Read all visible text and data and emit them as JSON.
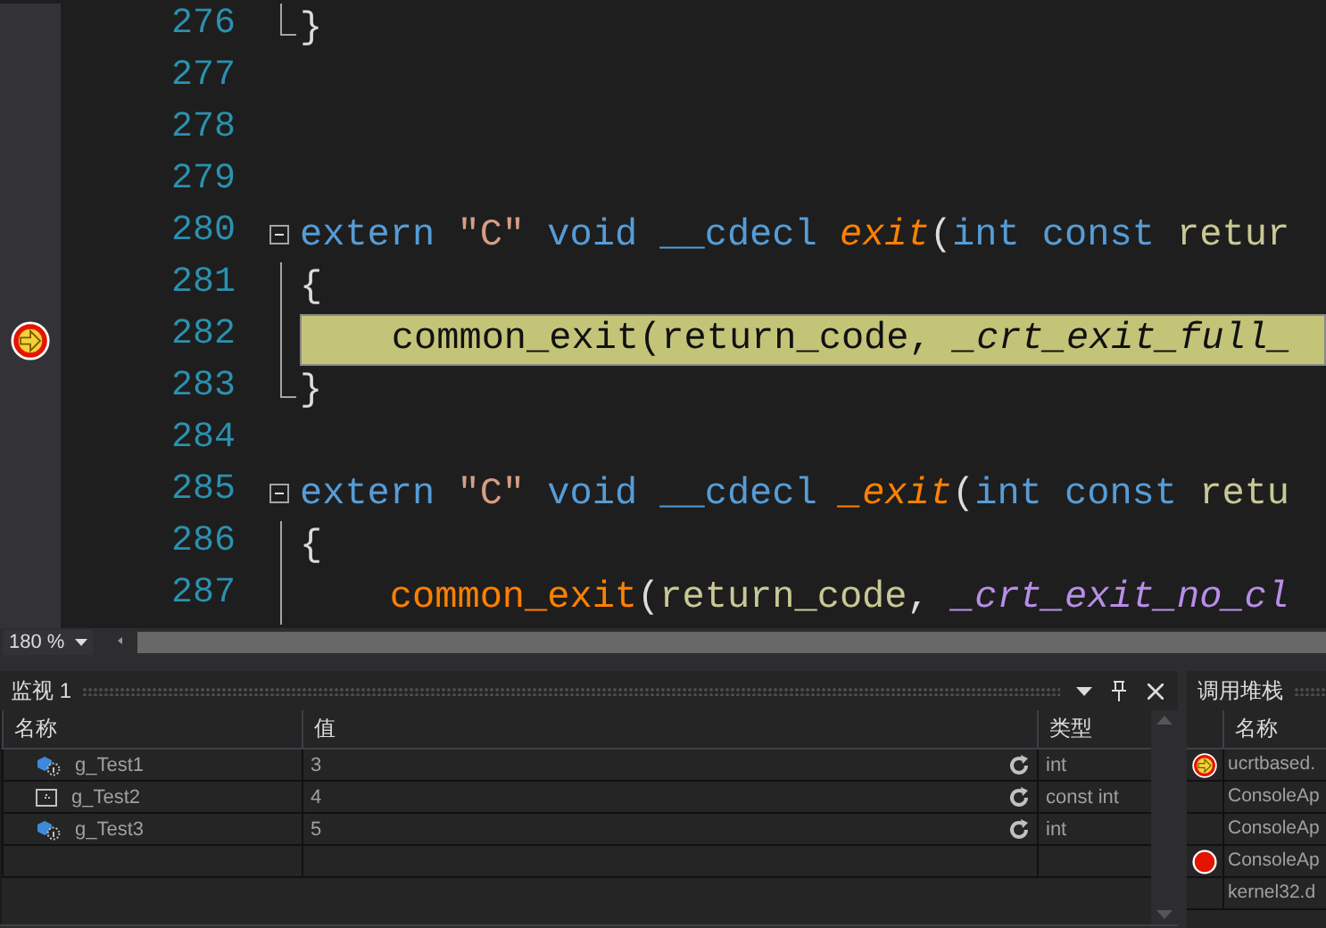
{
  "editor": {
    "zoom": "180 %",
    "lines": [
      {
        "number": "276",
        "collapsible": false,
        "in_block": true,
        "block_end": true,
        "current": false,
        "tokens": [
          {
            "kind": "plain",
            "text": "}"
          }
        ]
      },
      {
        "number": "277",
        "collapsible": false,
        "in_block": false,
        "block_end": false,
        "current": false
      },
      {
        "number": "278",
        "collapsible": false,
        "in_block": false,
        "block_end": false,
        "current": false
      },
      {
        "number": "279",
        "collapsible": false,
        "in_block": false,
        "block_end": false,
        "current": false
      },
      {
        "number": "280",
        "collapsible": true,
        "in_block": false,
        "block_end": false,
        "current": false,
        "tokens": [
          {
            "kind": "keyword",
            "text": "extern "
          },
          {
            "kind": "string",
            "text": "\"C\""
          },
          {
            "kind": "keyword",
            "text": " void __cdecl "
          },
          {
            "kind": "function_italic",
            "text": "exit"
          },
          {
            "kind": "plain",
            "text": "("
          },
          {
            "kind": "keyword",
            "text": "int const "
          },
          {
            "kind": "param",
            "text": "retur"
          }
        ]
      },
      {
        "number": "281",
        "collapsible": false,
        "in_block": true,
        "block_end": false,
        "current": false,
        "tokens": [
          {
            "kind": "plain",
            "text": "{"
          }
        ]
      },
      {
        "number": "282",
        "collapsible": false,
        "in_block": true,
        "block_end": false,
        "current": true,
        "tokens": [
          {
            "kind": "plain",
            "text": "    common_exit(return_code, "
          },
          {
            "kind": "macro",
            "text": "_crt_exit_full_"
          }
        ]
      },
      {
        "number": "283",
        "collapsible": false,
        "in_block": true,
        "block_end": true,
        "current": false,
        "tokens": [
          {
            "kind": "plain",
            "text": "}"
          }
        ]
      },
      {
        "number": "284",
        "collapsible": false,
        "in_block": false,
        "block_end": false,
        "current": false
      },
      {
        "number": "285",
        "collapsible": true,
        "in_block": false,
        "block_end": false,
        "current": false,
        "tokens": [
          {
            "kind": "keyword",
            "text": "extern "
          },
          {
            "kind": "string",
            "text": "\"C\""
          },
          {
            "kind": "keyword",
            "text": " void __cdecl "
          },
          {
            "kind": "function_italic",
            "text": "_exit"
          },
          {
            "kind": "plain",
            "text": "("
          },
          {
            "kind": "keyword",
            "text": "int const "
          },
          {
            "kind": "param",
            "text": "retu"
          }
        ]
      },
      {
        "number": "286",
        "collapsible": false,
        "in_block": true,
        "block_end": false,
        "current": false,
        "tokens": [
          {
            "kind": "plain",
            "text": "{"
          }
        ]
      },
      {
        "number": "287",
        "collapsible": false,
        "in_block": true,
        "block_end": false,
        "current": false,
        "tokens": [
          {
            "kind": "function",
            "text": "    common_exit"
          },
          {
            "kind": "plain",
            "text": "("
          },
          {
            "kind": "param",
            "text": "return_code"
          },
          {
            "kind": "plain",
            "text": ", "
          },
          {
            "kind": "macro",
            "text": "_crt_exit_no_cl"
          }
        ]
      }
    ]
  },
  "watch": {
    "title": "监视 1",
    "columns": [
      "名称",
      "值",
      "类型"
    ],
    "rows": [
      {
        "kind": "variable",
        "name": "g_Test1",
        "value": "3",
        "type": "int"
      },
      {
        "kind": "constant",
        "name": "g_Test2",
        "value": "4",
        "type": "const int"
      },
      {
        "kind": "variable",
        "name": "g_Test3",
        "value": "5",
        "type": "int"
      }
    ]
  },
  "call_stack": {
    "title": "调用堆栈",
    "columns": [
      "名称"
    ],
    "rows": [
      {
        "kind": "current",
        "name": "ucrtbased."
      },
      {
        "kind": "frame",
        "name": "ConsoleAp"
      },
      {
        "kind": "frame",
        "name": "ConsoleAp"
      },
      {
        "kind": "breakpoint",
        "name": "ConsoleAp"
      },
      {
        "kind": "frame",
        "name": "kernel32.d"
      }
    ]
  }
}
